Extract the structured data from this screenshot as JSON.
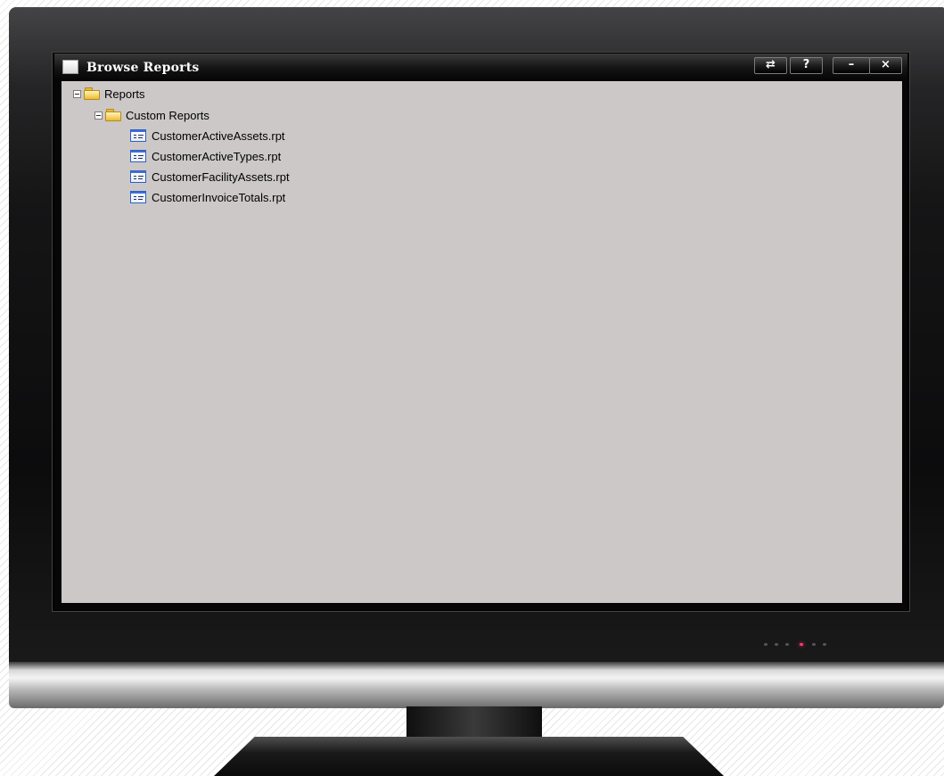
{
  "window": {
    "title": "Browse Reports",
    "buttons": {
      "swap": "⇄",
      "help": "?",
      "minimize": "–",
      "close": "×"
    }
  },
  "tree": {
    "root": {
      "label": "Reports",
      "icon": "folder-open-icon",
      "expanded": true
    },
    "folder": {
      "label": "Custom Reports",
      "icon": "folder-open-icon",
      "expanded": true
    },
    "files": [
      {
        "label": "CustomerActiveAssets.rpt",
        "icon": "report-file-icon"
      },
      {
        "label": "CustomerActiveTypes.rpt",
        "icon": "report-file-icon"
      },
      {
        "label": "CustomerFacilityAssets.rpt",
        "icon": "report-file-icon"
      },
      {
        "label": "CustomerInvoiceTotals.rpt",
        "icon": "report-file-icon"
      }
    ]
  },
  "colors": {
    "content_background": "#ccc8c8",
    "titlebar": "#141414",
    "power_led": "#ff3b6b"
  }
}
